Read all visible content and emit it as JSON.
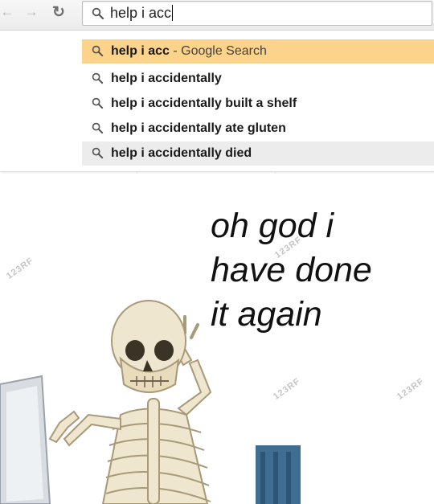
{
  "browser": {
    "back_icon": "back-arrow-icon",
    "forward_icon": "forward-arrow-icon",
    "reload_icon": "reload-icon",
    "omnibox": {
      "query": "help i acc",
      "icon": "search-icon"
    }
  },
  "suggestions": [
    {
      "bold": "help i acc",
      "suffix": " - Google Search",
      "state": "highlighted"
    },
    {
      "bold": "help i accidentally",
      "suffix": "",
      "state": "normal"
    },
    {
      "bold": "help i accidentally built a shelf",
      "suffix": "",
      "state": "normal"
    },
    {
      "bold": "help i accidentally ate gluten",
      "suffix": "",
      "state": "normal"
    },
    {
      "bold": "help i accidentally died",
      "suffix": "",
      "state": "hover"
    }
  ],
  "meme": {
    "caption_lines": [
      "oh god i",
      "have done",
      "it again"
    ],
    "watermark": "123RF"
  },
  "colors": {
    "highlight": "#fbd38b",
    "hover": "#ececec",
    "bone": "#efe6cf",
    "chair": "#3f6e91"
  }
}
